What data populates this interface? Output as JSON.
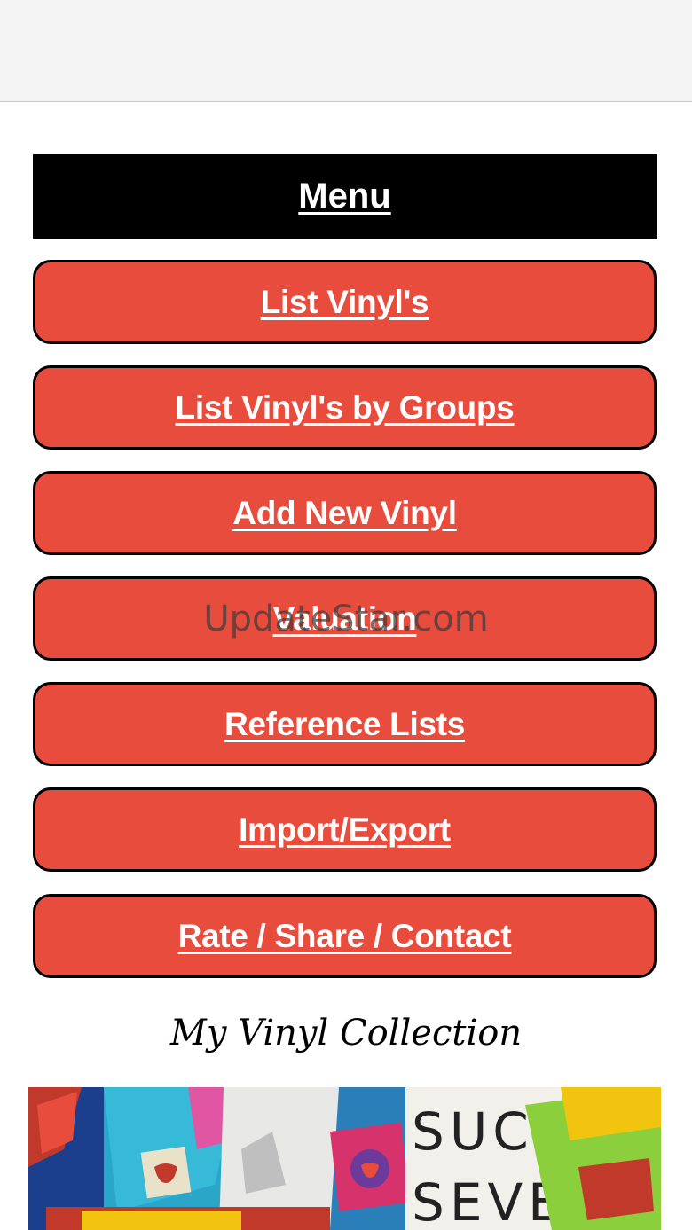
{
  "menu": {
    "title": "Menu",
    "items": [
      {
        "label": "List Vinyl's"
      },
      {
        "label": "List Vinyl's by Groups"
      },
      {
        "label": "Add New Vinyl"
      },
      {
        "label": "Valuation"
      },
      {
        "label": "Reference Lists"
      },
      {
        "label": "Import/Export"
      },
      {
        "label": "Rate / Share / Contact"
      }
    ]
  },
  "watermark": "UpdateStar.com",
  "collection_title": "My Vinyl Collection",
  "collage_image": {
    "text": "SUCKIN SEVEN",
    "content": "Collage of vinyl album covers including Rolling Stones tongue logos"
  },
  "colors": {
    "button_fill": "#e84c3d",
    "button_border": "#000000",
    "header_fill": "#000000",
    "label_text": "#ffffff"
  }
}
